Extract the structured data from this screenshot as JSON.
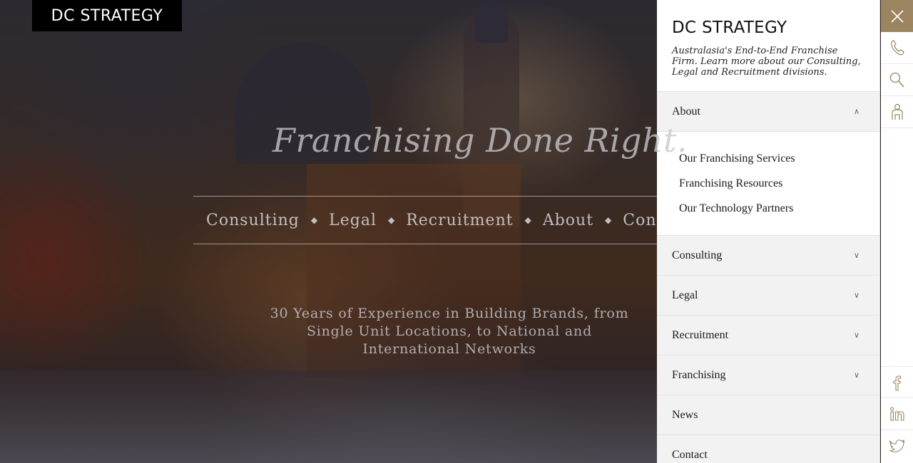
{
  "brand": {
    "logo_text": "DC STRATEGY"
  },
  "hero": {
    "title": "Franchising Done Right.",
    "nav": [
      "Consulting",
      "Legal",
      "Recruitment",
      "About",
      "Con"
    ],
    "subtitle": "30 Years of Experience in Building Brands, from Single Unit Locations, to National and International Networks"
  },
  "panel": {
    "logo_text": "DC STRATEGY",
    "tagline": "Australasia's End-to-End Franchise Firm. Learn more about our Consulting, Legal and Recruitment divisions.",
    "menu": [
      {
        "label": "About",
        "expanded": true,
        "icon": "chevron-up-icon"
      },
      {
        "label": "Consulting",
        "icon": "chevron-down-icon"
      },
      {
        "label": "Legal",
        "icon": "chevron-down-icon"
      },
      {
        "label": "Recruitment",
        "icon": "chevron-down-icon"
      },
      {
        "label": "Franchising",
        "icon": "chevron-down-icon"
      },
      {
        "label": "News"
      },
      {
        "label": "Contact"
      }
    ],
    "about_submenu": [
      "Our Franchising Services",
      "Franchising Resources",
      "Our Technology Partners"
    ]
  },
  "iconbar": {
    "top": [
      "close-icon",
      "phone-icon",
      "search-icon",
      "user-icon"
    ],
    "social": [
      "facebook-icon",
      "linkedin-icon",
      "twitter-icon"
    ],
    "accent_color": "#9b8561"
  }
}
